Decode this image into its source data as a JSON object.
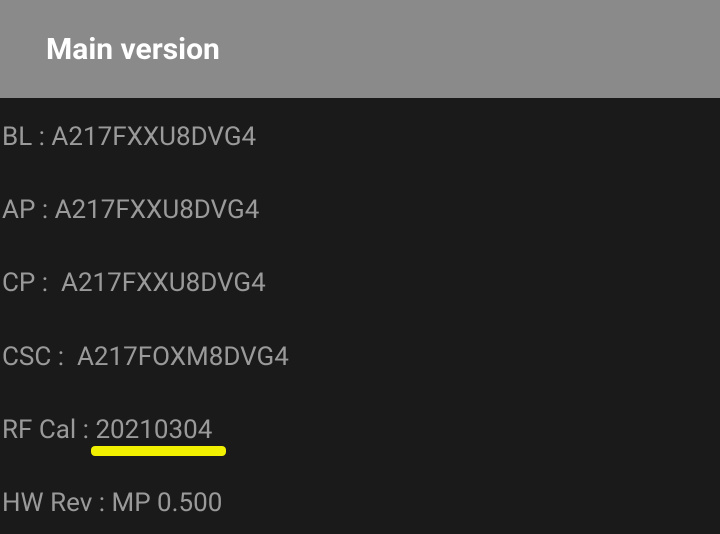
{
  "header": {
    "title": "Main version"
  },
  "rows": {
    "bl_label": "BL : ",
    "bl_value": "A217FXXU8DVG4",
    "ap_label": "AP : ",
    "ap_value": "A217FXXU8DVG4",
    "cp_label": "CP :  ",
    "cp_value": "A217FXXU8DVG4",
    "csc_label": "CSC :  ",
    "csc_value": "A217FOXM8DVG4",
    "rfcal_label": "RF Cal : ",
    "rfcal_value": "20210304",
    "hwrev_label": "HW Rev : ",
    "hwrev_value": "MP 0.500"
  }
}
